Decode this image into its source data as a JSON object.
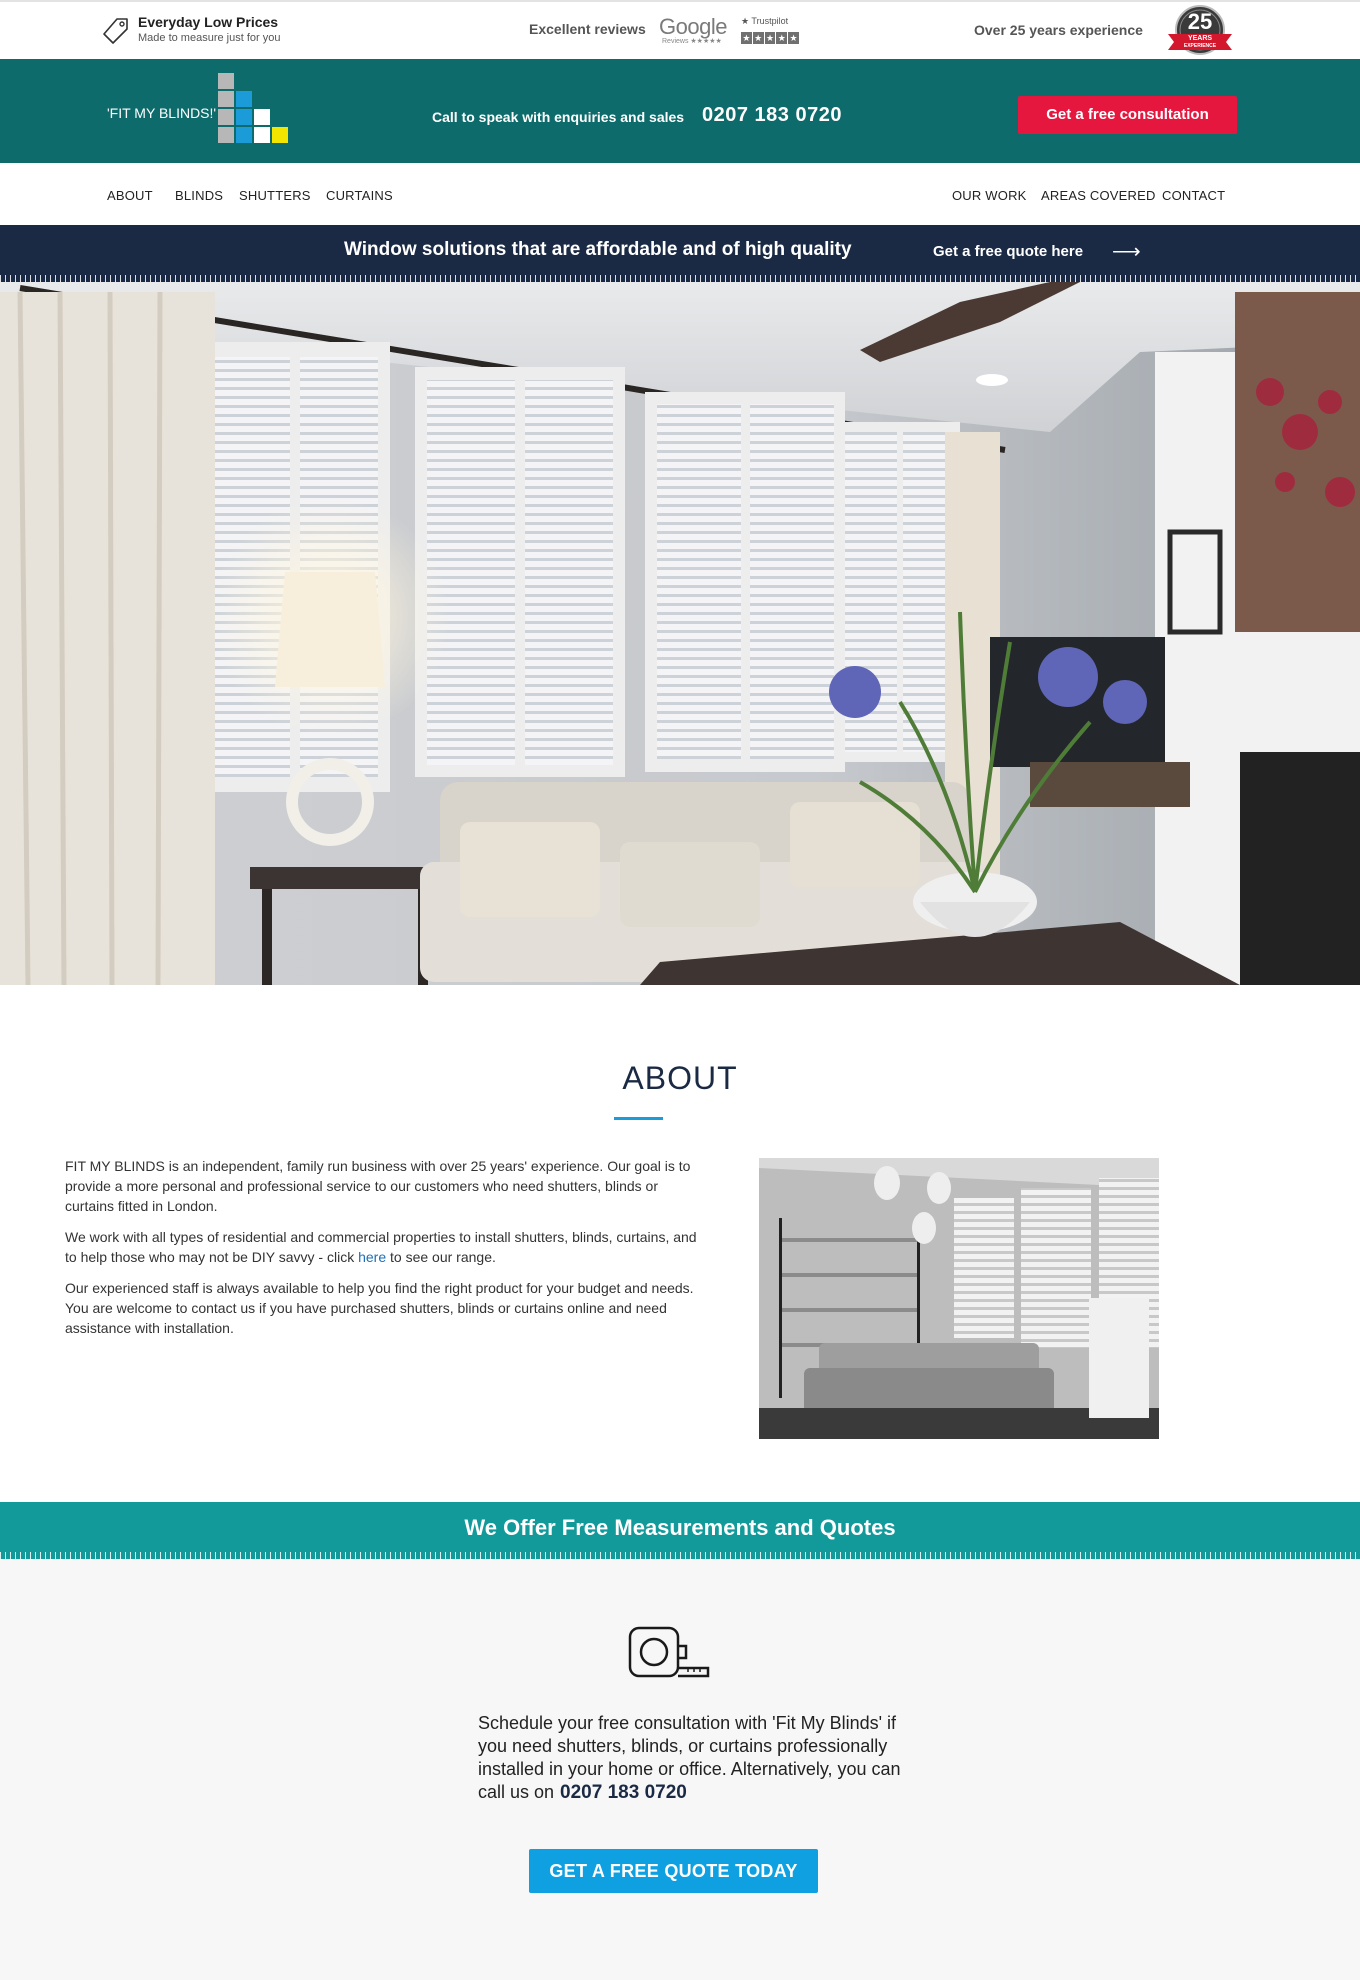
{
  "topbar": {
    "prices_title": "Everyday Low Prices",
    "prices_subtitle": "Made to measure just for you",
    "reviews_label": "Excellent reviews",
    "google_logo": "Google",
    "google_sub": "Reviews ★★★★★",
    "trustpilot_label": "★ Trustpilot",
    "experience_label": "Over 25 years experience",
    "badge_number": "25",
    "badge_years": "YEARS",
    "badge_experience": "EXPERIENCE",
    "icons": {
      "tag": "price-tag-icon",
      "badge": "25-years-badge"
    }
  },
  "header": {
    "logo_text": "'FIT MY BLINDS!'",
    "call_label": "Call to speak with enquiries and sales",
    "phone": "0207 183 0720",
    "cta": "Get a free consultation"
  },
  "nav": {
    "left": [
      "ABOUT",
      "BLINDS",
      "SHUTTERS",
      "CURTAINS"
    ],
    "right": [
      "OUR WORK",
      "AREAS COVERED",
      "CONTACT"
    ]
  },
  "promo": {
    "headline": "Window solutions that are affordable and of high quality",
    "link": "Get a free quote here",
    "arrow_icon": "arrow-right-icon"
  },
  "about": {
    "title": "ABOUT",
    "p1": "FIT MY BLINDS is an independent, family run business with over 25 years' experience. Our goal is to provide a more personal and professional service to our customers who need shutters, blinds or curtains fitted in London.",
    "p2_before": "We work with all types of residential and commercial properties to install shutters, blinds, curtains, and to help those who may not be DIY savvy - click ",
    "p2_link": "here",
    "p2_after": " to see our range.",
    "p3": "Our experienced staff is always available to help you find the right product for your budget and needs. You are welcome to contact us if you have purchased shutters, blinds or curtains online and need assistance with installation."
  },
  "measurements": {
    "title": "We Offer Free Measurements and Quotes",
    "icon": "tape-measure-icon",
    "text": "Schedule your free consultation with 'Fit My Blinds' if you need shutters, blinds, or curtains professionally installed in your home or office. Alternatively, you can call us on",
    "phone": "0207 183 0720",
    "cta": "GET A FREE QUOTE TODAY"
  },
  "colors": {
    "header_teal": "#0e6b6b",
    "navy": "#1b2a44",
    "cta_red": "#e6173f",
    "measure_teal": "#12999a",
    "quote_blue": "#0ea0e0",
    "accent_blue": "#1b9bd7"
  }
}
